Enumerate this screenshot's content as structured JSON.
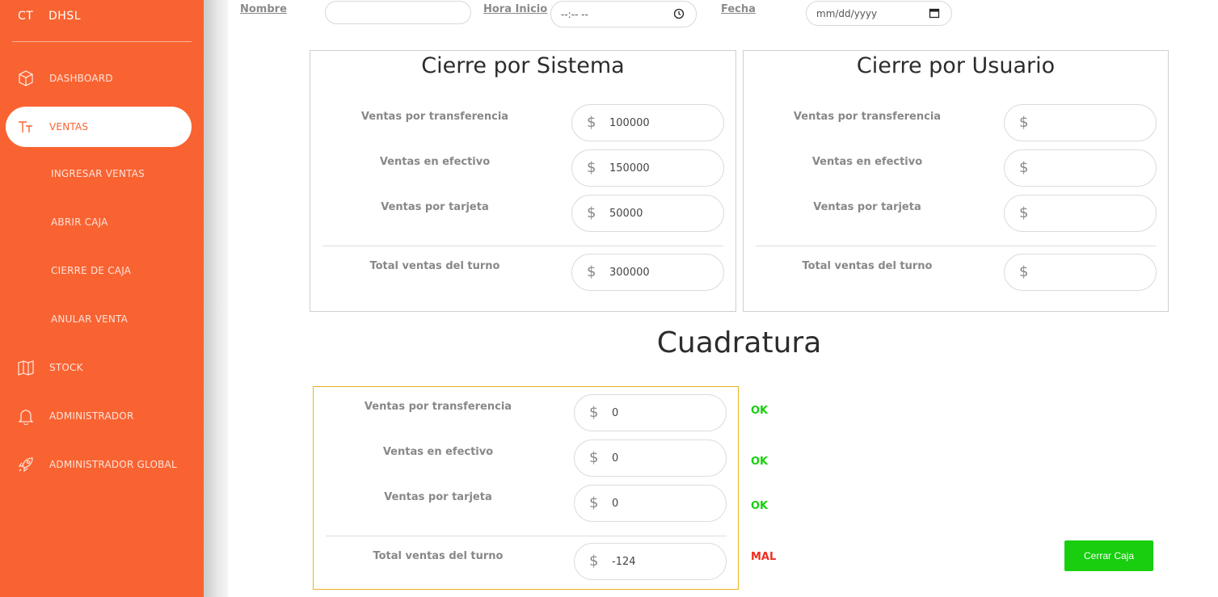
{
  "brand": {
    "mini": "CT",
    "name": "DHSL"
  },
  "nav": {
    "dashboard": "DASHBOARD",
    "ventas": "VENTAS",
    "ingresar_ventas": "INGRESAR VENTAS",
    "abrir_caja": "ABRIR CAJA",
    "cierre_de_caja": "CIERRE DE CAJA",
    "anular_venta": "ANULAR VENTA",
    "stock": "STOCK",
    "administrador": "ADMINISTRADOR",
    "administrador_global": "ADMINISTRADOR GLOBAL"
  },
  "filters": {
    "nombre_label": "Nombre",
    "nombre_value": "",
    "hora_label": "Hora Inicio",
    "hora_value": "--:-- --",
    "fecha_label": "Fecha",
    "fecha_value": "mm/dd/yyyy"
  },
  "sistema": {
    "title": "Cierre por Sistema",
    "currency": "$",
    "rows": [
      {
        "label": "Ventas por transferencia",
        "value": "100000"
      },
      {
        "label": "Ventas en efectivo",
        "value": "150000"
      },
      {
        "label": "Ventas por tarjeta",
        "value": "50000"
      }
    ],
    "total_label": "Total ventas del turno",
    "total_value": "300000"
  },
  "usuario": {
    "title": "Cierre por Usuario",
    "currency": "$",
    "rows": [
      {
        "label": "Ventas por transferencia",
        "value": ""
      },
      {
        "label": "Ventas en efectivo",
        "value": ""
      },
      {
        "label": "Ventas por tarjeta",
        "value": ""
      }
    ],
    "total_label": "Total ventas del turno",
    "total_value": ""
  },
  "cuadratura": {
    "title": "Cuadratura",
    "currency": "$",
    "rows": [
      {
        "label": "Ventas por transferencia",
        "value": "0",
        "status": "OK"
      },
      {
        "label": "Ventas en efectivo",
        "value": "0",
        "status": "OK"
      },
      {
        "label": "Ventas por tarjeta",
        "value": "0",
        "status": "OK"
      }
    ],
    "total_label": "Total ventas del turno",
    "total_value": "-124",
    "total_status": "MAL"
  },
  "colors": {
    "sidebar": "#f96332",
    "ok": "#18ce0f",
    "mal": "#ee2d20",
    "button": "#18ce0f",
    "panel_border_gold": "#e6b422"
  },
  "button": {
    "cerrar_caja": "Cerrar Caja"
  }
}
